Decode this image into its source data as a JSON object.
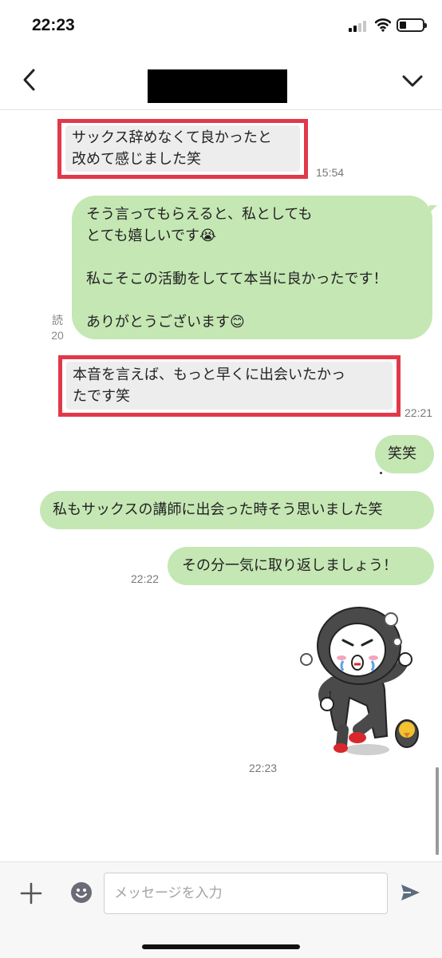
{
  "status_bar": {
    "time": "22:23",
    "icons": [
      "signal-icon",
      "wifi-icon",
      "battery-icon"
    ]
  },
  "header": {
    "contact_name": "",
    "back_icon": "chevron-left-icon",
    "menu_icon": "chevron-down-icon"
  },
  "messages": [
    {
      "direction": "in",
      "text": "サックス辞めなくて良かったと\n改めて感じました笑",
      "time": "15:54",
      "highlighted": true
    },
    {
      "direction": "out",
      "text": "そう言ってもらえると、私としても\nとても嬉しいです😭\n\n私こそこの活動をしてて本当に良かったです！\n\nありがとうございます😊",
      "read_label": "読",
      "read_count": "20"
    },
    {
      "direction": "in",
      "text": "本音を言えば、もっと早くに出会いたかっ\nたです笑",
      "time": "22:21",
      "highlighted": true
    },
    {
      "direction": "out",
      "text": "笑笑"
    },
    {
      "direction": "out",
      "text": "私もサックスの講師に出会った時そう思いました笑"
    },
    {
      "direction": "out",
      "text": "その分一気に取り返しましょう！",
      "time": "22:22"
    },
    {
      "direction": "out",
      "type": "sticker",
      "sticker": "running-hooded-character-sticker",
      "time": "22:23"
    }
  ],
  "input_bar": {
    "placeholder": "メッセージを入力",
    "value": "",
    "icons": [
      "plus-icon",
      "emoji-icon",
      "send-icon"
    ]
  },
  "colors": {
    "outgoing_bubble": "#c5e7b4",
    "incoming_bubble": "#ededed",
    "highlight_border": "#e2384a"
  }
}
